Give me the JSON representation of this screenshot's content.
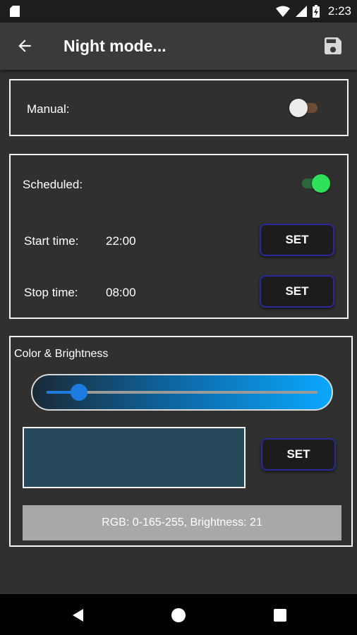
{
  "status_bar": {
    "time": "2:23"
  },
  "app_bar": {
    "title": "Night mode..."
  },
  "manual": {
    "label": "Manual:",
    "enabled": false
  },
  "scheduled": {
    "label": "Scheduled:",
    "enabled": true,
    "start": {
      "label": "Start time:",
      "value": "22:00",
      "button": "SET"
    },
    "stop": {
      "label": "Stop time:",
      "value": "08:00",
      "button": "SET"
    }
  },
  "color": {
    "heading": "Color & Brightness",
    "brightness_fraction": 0.12,
    "preview_color": "#264a5c",
    "button": "SET",
    "readout": "RGB: 0-165-255, Brightness: 21"
  },
  "colors": {
    "toggle_on": "#2ee05a",
    "button_border": "#2a2a9a",
    "slider_accent": "#1e7be0"
  },
  "icons": [
    "sd-card-icon",
    "wifi-icon",
    "signal-icon",
    "battery-icon",
    "back-arrow-icon",
    "save-icon",
    "nav-back-icon",
    "nav-home-icon",
    "nav-recents-icon"
  ]
}
